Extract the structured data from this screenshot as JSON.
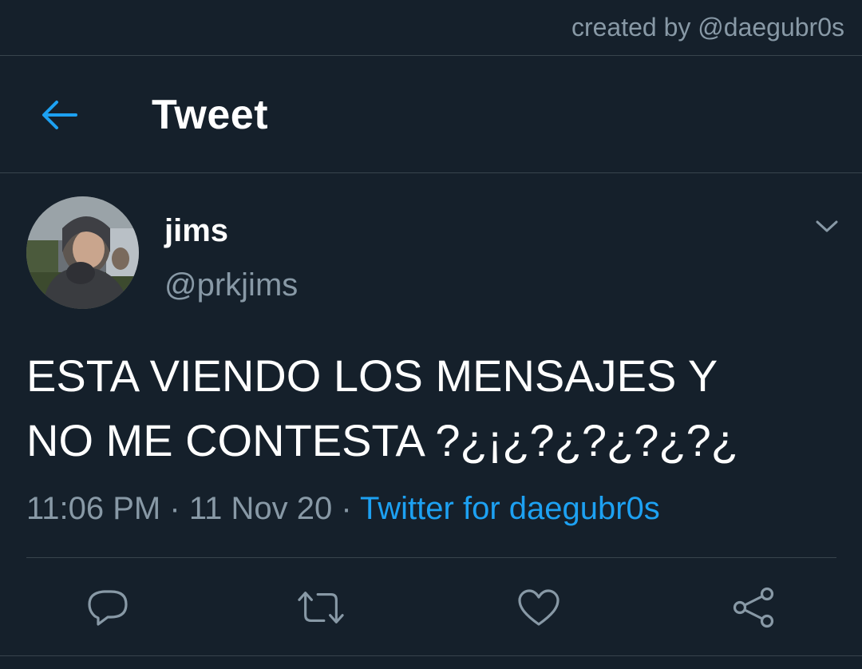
{
  "watermark": {
    "text": "created by @daegubr0s"
  },
  "header": {
    "title": "Tweet",
    "back_icon": "arrow-left-icon"
  },
  "tweet": {
    "author": {
      "display_name": "jims",
      "handle": "@prkjims"
    },
    "text": "ESTA VIENDO LOS MENSAJES Y\nNO ME CONTESTA ?¿¡¿?¿?¿?¿?¿",
    "time": "11:06 PM",
    "date": "11 Nov 20",
    "separator": "·",
    "source": "Twitter for daegubr0s",
    "actions": [
      {
        "name": "reply",
        "icon": "reply-icon"
      },
      {
        "name": "retweet",
        "icon": "retweet-icon"
      },
      {
        "name": "like",
        "icon": "heart-icon"
      },
      {
        "name": "share",
        "icon": "share-icon"
      }
    ]
  },
  "colors": {
    "background": "#15202b",
    "accent": "#1da1f2",
    "secondary_text": "#8899a6",
    "divider": "#38444d",
    "primary_text": "#ffffff"
  }
}
